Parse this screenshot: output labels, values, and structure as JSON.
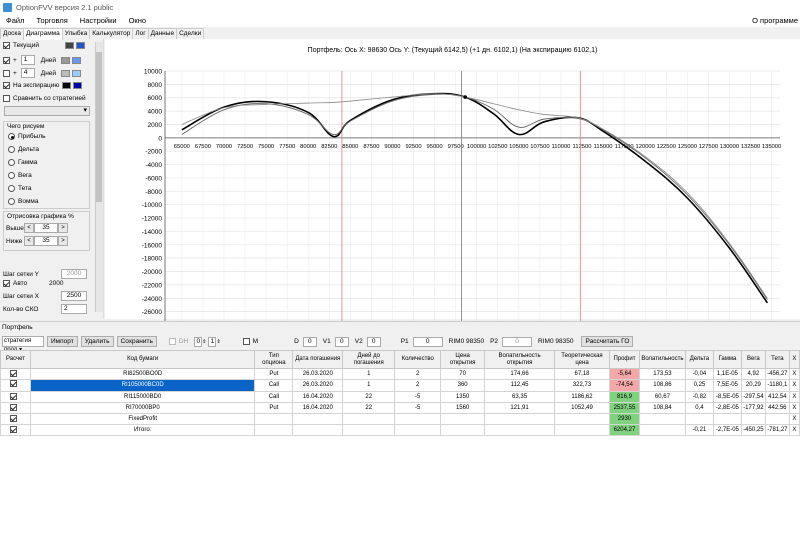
{
  "app": {
    "title": "OptionFVV версия 2.1 public"
  },
  "menu": [
    "Файл",
    "Торговля",
    "Настройки",
    "Окно"
  ],
  "menu_right": "О программе",
  "tabs": [
    "Доска",
    "Диаграмма",
    "Улыбка",
    "Калькулятор",
    "Лог",
    "Данные",
    "Сделки"
  ],
  "left": {
    "current_label": "Текущий",
    "plus1_sign": "+",
    "plus1_val": "1",
    "plus1_label": "Дней",
    "plus2_sign": "+",
    "plus2_val": "4",
    "plus2_label": "Дней",
    "expiry_label": "На экспирацию",
    "compare_label": "Сравнить со стратегией",
    "draw_title": "Чего рисуем",
    "radios": [
      "Прибыль",
      "Дельта",
      "Гамма",
      "Вега",
      "Тета",
      "Вомма"
    ],
    "render_title": "Отрисовка графика %",
    "above_label": "Выше",
    "above_val": "35",
    "below_label": "Ниже",
    "below_val": "35",
    "gridy_label": "Шаг сетки Y",
    "gridy_val": "2000",
    "auto_label": "Авто",
    "auto_val": "2000",
    "gridx_label": "Шаг сетки X",
    "gridx_val": "2500",
    "sko_label": "Кол-во СКО",
    "sko_val": "2",
    "colors": {
      "current": [
        "#444444",
        "#2255cc"
      ],
      "plus1": [
        "#999999",
        "#6699ff"
      ],
      "plus2": [
        "#bbbbbb",
        "#99ccff"
      ],
      "expiry": [
        "#000000",
        "#0000aa"
      ]
    }
  },
  "chart_data": {
    "type": "line",
    "title": "Портфель: Ось X: 98630 Ось Y:  (Текущий 6142,5)  (+1 дн. 6102,1)  (На экспирацию 6102,1)",
    "x_ticks": [
      65000,
      67500,
      70000,
      72500,
      75000,
      77500,
      80000,
      82500,
      85000,
      87500,
      90000,
      92500,
      95000,
      97500,
      100000,
      102500,
      105000,
      107500,
      110000,
      112500,
      115000,
      117500,
      120000,
      122500,
      125000,
      127500,
      130000,
      132500,
      135000
    ],
    "y_ticks": [
      10000,
      8000,
      6000,
      4000,
      2000,
      0,
      -2000,
      -4000,
      -6000,
      -8000,
      -10000,
      -12000,
      -14000,
      -16000,
      -18000,
      -20000,
      -22000,
      -24000,
      -26000,
      -28000
    ],
    "xlim": [
      63000,
      136000
    ],
    "ylim": [
      -28000,
      10000
    ],
    "grid": true,
    "vlines": [
      {
        "x": 84000,
        "color": "#e08c8c"
      },
      {
        "x": 98200,
        "color": "#888888"
      },
      {
        "x": 112300,
        "color": "#e08c8c"
      }
    ],
    "series": [
      {
        "color": "#000000",
        "x": [
          65000,
          70000,
          75000,
          80000,
          83000,
          85000,
          90000,
          95000,
          98630,
          102000,
          105000,
          108000,
          112000,
          115000,
          120000,
          125000,
          130000,
          134500
        ],
        "y": [
          1200,
          4600,
          5400,
          3800,
          200,
          2600,
          5700,
          6600,
          6100,
          3600,
          500,
          2400,
          3000,
          1000,
          -3500,
          -9000,
          -16500,
          -24700
        ]
      },
      {
        "color": "#666666",
        "x": [
          65000,
          70000,
          75000,
          80000,
          83000,
          85000,
          90000,
          95000,
          98630,
          102000,
          105000,
          108000,
          112000,
          115000,
          120000,
          125000,
          130000,
          134500
        ],
        "y": [
          500,
          4200,
          5100,
          3500,
          500,
          2500,
          5500,
          6500,
          6100,
          4300,
          1600,
          2800,
          2900,
          1200,
          -3000,
          -8500,
          -16000,
          -24200
        ]
      },
      {
        "color": "#888888",
        "x": [
          65000,
          70000,
          75000,
          80000,
          83000,
          85000,
          90000,
          95000,
          98630,
          102000,
          105000,
          108000,
          112000,
          115000,
          120000,
          125000,
          130000,
          134500
        ],
        "y": [
          2000,
          4500,
          5000,
          5200,
          5300,
          5500,
          6100,
          6600,
          6100,
          5100,
          4200,
          3500,
          3000,
          1300,
          -2800,
          -8200,
          -15800,
          -24000
        ]
      }
    ]
  },
  "portfolio": {
    "label": "Портфель",
    "strategy_select": "стратегия прод",
    "import": "Импорт",
    "delete": "Удалить",
    "save": "Сохранить",
    "dh": "DH",
    "v0": "0",
    "v1": "1",
    "m": "M",
    "d": "D",
    "d_val": "0",
    "v1l": "V1",
    "v1_val": "0",
    "v2l": "V2",
    "v2_val": "0",
    "p1": "P1",
    "p1_val": "0",
    "rim1": "RIM0 98350",
    "p2": "P2",
    "p2_val": "0",
    "rim2": "RIM0 98350",
    "calc_go": "Рассчитать ГО",
    "headers": [
      "Расчет",
      "Код бумаги",
      "Тип опциона",
      "Дата погашения",
      "Дней до погашения",
      "Количество",
      "Цена открытия",
      "Волатильность открытия",
      "Теоретическая цена",
      "Профит",
      "Волатильность",
      "Дельта",
      "Гамма",
      "Вега",
      "Тета",
      "X"
    ],
    "rows": [
      {
        "code": "RI82500BO0D",
        "type": "Put",
        "date": "26.03.2020",
        "days": "1",
        "qty": "2",
        "price": "70",
        "vol_open": "174,66",
        "theo": "67,18",
        "profit": "-5,64",
        "vol": "173,53",
        "delta": "-0,04",
        "gamma": "1,1E-05",
        "vega": "4,92",
        "theta": "-456,27",
        "x": "X"
      },
      {
        "code": "RI105000BC0D",
        "type": "Call",
        "date": "26.03.2020",
        "days": "1",
        "qty": "2",
        "price": "360",
        "vol_open": "112,45",
        "theo": "322,73",
        "profit": "-74,54",
        "vol": "108,86",
        "delta": "0,25",
        "gamma": "7,5E-05",
        "vega": "20,29",
        "theta": "-1180,1",
        "x": "X"
      },
      {
        "code": "RI115000BD0",
        "type": "Call",
        "date": "16.04.2020",
        "days": "22",
        "qty": "-5",
        "price": "1350",
        "vol_open": "63,35",
        "theo": "1186,62",
        "profit": "816,9",
        "vol": "60,67",
        "delta": "-0,82",
        "gamma": "-8,5E-05",
        "vega": "-297,54",
        "theta": "412,54",
        "x": "X"
      },
      {
        "code": "RI70000BP0",
        "type": "Put",
        "date": "16.04.2020",
        "days": "22",
        "qty": "-5",
        "price": "1560",
        "vol_open": "121,91",
        "theo": "1052,49",
        "profit": "2537,55",
        "vol": "108,84",
        "delta": "0,4",
        "gamma": "-2,8E-05",
        "vega": "-177,92",
        "theta": "442,56",
        "x": "X"
      },
      {
        "code": "FixedProfit",
        "type": "",
        "date": "",
        "days": "",
        "qty": "",
        "price": "",
        "vol_open": "",
        "theo": "",
        "profit": "2930",
        "vol": "",
        "delta": "",
        "gamma": "",
        "vega": "",
        "theta": "",
        "x": "X"
      },
      {
        "code": "Итого:",
        "type": "",
        "date": "",
        "days": "",
        "qty": "",
        "price": "",
        "vol_open": "",
        "theo": "",
        "profit": "6204,27",
        "vol": "",
        "delta": "-0,21",
        "gamma": "-2,7E-05",
        "vega": "-450,25",
        "theta": "-781,27",
        "x": "X"
      }
    ]
  }
}
